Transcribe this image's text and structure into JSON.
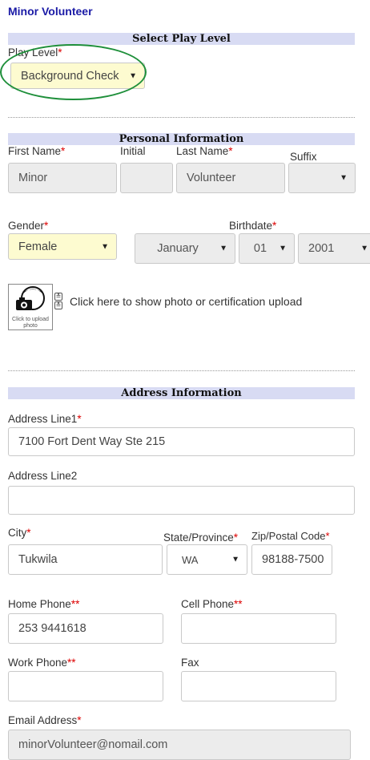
{
  "page": {
    "title": "Minor Volunteer"
  },
  "play_level_section": {
    "header": "Select Play Level",
    "label": "Play Level",
    "value": "Background Check"
  },
  "personal_section": {
    "header": "Personal Information",
    "first_name": {
      "label": "First Name",
      "value": "Minor"
    },
    "initial": {
      "label": "Initial",
      "value": ""
    },
    "last_name": {
      "label": "Last Name",
      "value": "Volunteer"
    },
    "suffix": {
      "label": "Suffix",
      "value": ""
    },
    "gender": {
      "label": "Gender",
      "value": "Female"
    },
    "birthdate": {
      "label": "Birthdate",
      "month": "January",
      "day": "01",
      "year": "2001"
    }
  },
  "photo": {
    "caption": "Click to upload photo",
    "link_text": "Click here to show photo or certification upload"
  },
  "address_section": {
    "header": "Address Information",
    "line1": {
      "label": "Address Line1",
      "value": "7100 Fort Dent Way Ste 215"
    },
    "line2": {
      "label": "Address Line2",
      "value": ""
    },
    "city": {
      "label": "City",
      "value": "Tukwila"
    },
    "state": {
      "label": "State/Province",
      "value": "WA"
    },
    "zip": {
      "label": "Zip/Postal Code",
      "value": "98188-7500"
    },
    "home_phone": {
      "label": "Home Phone",
      "value": "253 9441618"
    },
    "cell_phone": {
      "label": "Cell Phone",
      "value": ""
    },
    "work_phone": {
      "label": "Work Phone",
      "value": ""
    },
    "fax": {
      "label": "Fax",
      "value": ""
    },
    "email": {
      "label": "Email Address",
      "value": "minorVolunteer@nomail.com"
    }
  },
  "markers": {
    "required": "*",
    "required_one_of": "**"
  },
  "colors": {
    "section_bar": "#d8dbf3",
    "highlight_field": "#fdfbd0",
    "required": "#dd0000",
    "annotation_oval": "#1e8f3a",
    "title": "#1a1aa6"
  },
  "icons": {
    "select_caret": "caret-down-icon",
    "photo": "camera-person-icon",
    "expand": "double-chevron-down-icon"
  }
}
